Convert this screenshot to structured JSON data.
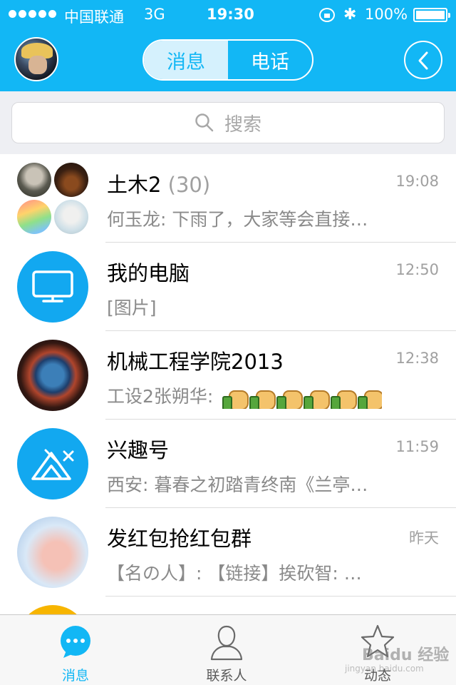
{
  "status": {
    "carrier": "中国联通",
    "network": "3G",
    "time": "19:30",
    "battery": "100%",
    "battery_level": 1.0
  },
  "header": {
    "tabs": [
      "消息",
      "电话"
    ],
    "active_tab": 0
  },
  "search": {
    "placeholder": "搜索"
  },
  "conversations": [
    {
      "name": "土木2",
      "count": "(30)",
      "time": "19:08",
      "message": "何玉龙: 下雨了，大家等会直接…"
    },
    {
      "name": "我的电脑",
      "count": "",
      "time": "12:50",
      "message": "[图片]"
    },
    {
      "name": "机械工程学院2013",
      "count": "",
      "time": "12:38",
      "message": "工设2张朔华: ",
      "emoji_count": 6
    },
    {
      "name": "兴趣号",
      "count": "",
      "time": "11:59",
      "message": "西安: 暮春之初踏青终南《兰亭…"
    },
    {
      "name": "发红包抢红包群",
      "count": "",
      "time": "昨天",
      "message": "【名の人】: 【链接】挨砍智: …"
    }
  ],
  "tabbar": {
    "items": [
      "消息",
      "联系人",
      "动态"
    ],
    "active": 0
  },
  "watermark": {
    "text": "Baidu 经验",
    "sub": "jingyan.baidu.com"
  },
  "colors": {
    "accent": "#12b7f5",
    "divider": "#dcdcdc",
    "secondary_text": "#8a8a8a"
  }
}
